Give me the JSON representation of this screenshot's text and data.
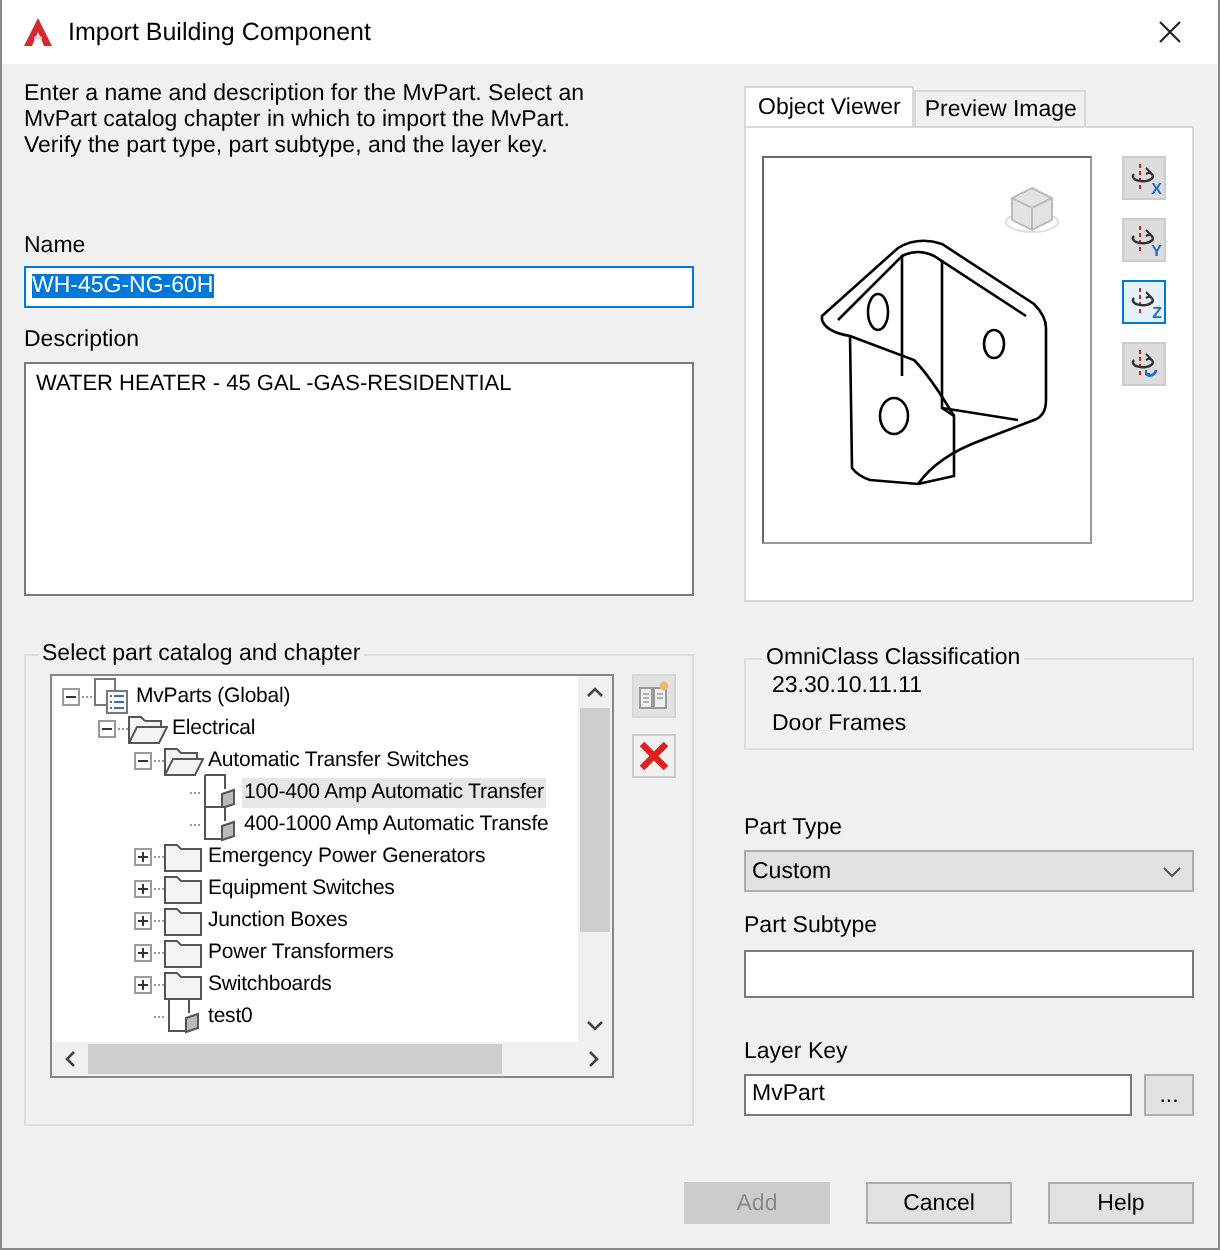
{
  "window": {
    "title": "Import Building Component"
  },
  "instructions": "Enter a name and description for the MvPart.  Select an MvPart catalog chapter in which to import the MvPart. Verify the part type, part subtype, and the layer key.",
  "name": {
    "label": "Name",
    "value": "WH-45G-NG-60H",
    "text_selected": true
  },
  "description": {
    "label": "Description",
    "value": "WATER HEATER - 45 GAL -GAS-RESIDENTIAL"
  },
  "catalog": {
    "title": "Select part catalog and chapter",
    "tree": [
      {
        "label": "MvParts (Global)",
        "kind": "catalog",
        "expanded": true,
        "selected": false,
        "children": [
          {
            "label": "Electrical",
            "kind": "folder",
            "expanded": true,
            "selected": false,
            "children": [
              {
                "label": "Automatic Transfer Switches",
                "kind": "folder",
                "expanded": true,
                "selected": false,
                "children": [
                  {
                    "label": "100-400 Amp Automatic Transfer",
                    "kind": "part",
                    "selected": true
                  },
                  {
                    "label": "400-1000 Amp Automatic Transfe",
                    "kind": "part",
                    "selected": false
                  }
                ]
              },
              {
                "label": "Emergency Power Generators",
                "kind": "folder",
                "expanded": false,
                "selected": false
              },
              {
                "label": "Equipment Switches",
                "kind": "folder",
                "expanded": false,
                "selected": false
              },
              {
                "label": "Junction Boxes",
                "kind": "folder",
                "expanded": false,
                "selected": false
              },
              {
                "label": "Power Transformers",
                "kind": "folder",
                "expanded": false,
                "selected": false
              },
              {
                "label": "Switchboards",
                "kind": "folder",
                "expanded": false,
                "selected": false
              },
              {
                "label": "test0",
                "kind": "part",
                "selected": false
              }
            ]
          }
        ]
      }
    ],
    "side_buttons": [
      {
        "kind": "new",
        "disabled": true
      },
      {
        "kind": "delete",
        "disabled": false
      }
    ]
  },
  "viewer": {
    "tabs": [
      {
        "label": "Object Viewer",
        "selected": true
      },
      {
        "label": "Preview Image",
        "selected": false
      }
    ],
    "rotate_buttons": [
      {
        "kind": "axis",
        "label": "X",
        "selected": false
      },
      {
        "kind": "axis",
        "label": "Y",
        "selected": false
      },
      {
        "kind": "axis",
        "label": "Z",
        "selected": true
      },
      {
        "kind": "reset",
        "selected": false
      }
    ]
  },
  "omniclass": {
    "title": "OmniClass Classification",
    "code": "23.30.10.11.11",
    "name": "Door Frames"
  },
  "part_type": {
    "label": "Part Type",
    "value": "Custom"
  },
  "part_subtype": {
    "label": "Part Subtype"
  },
  "layer_key": {
    "label": "Layer Key",
    "value": "MvPart",
    "browse": "..."
  },
  "buttons": [
    {
      "label": "Add",
      "disabled": true
    },
    {
      "label": "Cancel",
      "disabled": false
    },
    {
      "label": "Help",
      "disabled": false
    }
  ]
}
